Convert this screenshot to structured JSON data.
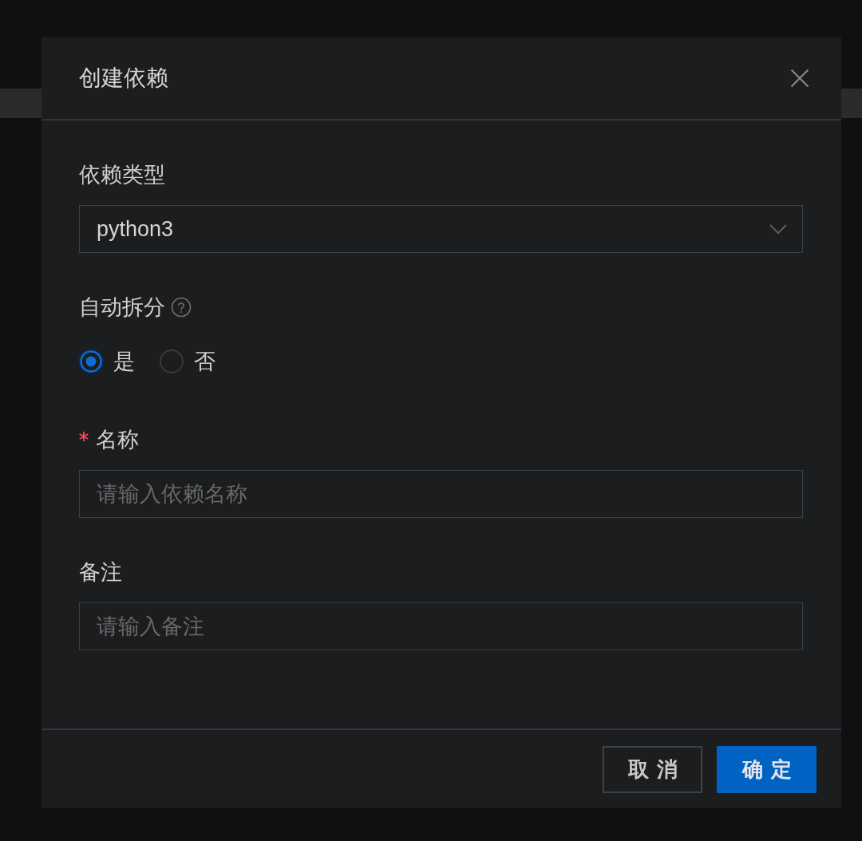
{
  "dialog": {
    "title": "创建依赖",
    "fields": [
      {
        "kind": "select",
        "label": "依赖类型",
        "required": false,
        "help": false,
        "value": "python3"
      },
      {
        "kind": "radio",
        "label": "自动拆分",
        "required": false,
        "help": true,
        "options": [
          {
            "label": "是",
            "selected": true
          },
          {
            "label": "否",
            "selected": false
          }
        ]
      },
      {
        "kind": "input",
        "label": "名称",
        "required": true,
        "help": false,
        "placeholder": "请输入依赖名称"
      },
      {
        "kind": "input",
        "label": "备注",
        "required": false,
        "help": false,
        "placeholder": "请输入备注"
      }
    ],
    "buttons": [
      {
        "kind": "secondary",
        "label": "取消"
      },
      {
        "kind": "primary",
        "label": "确定"
      }
    ]
  }
}
